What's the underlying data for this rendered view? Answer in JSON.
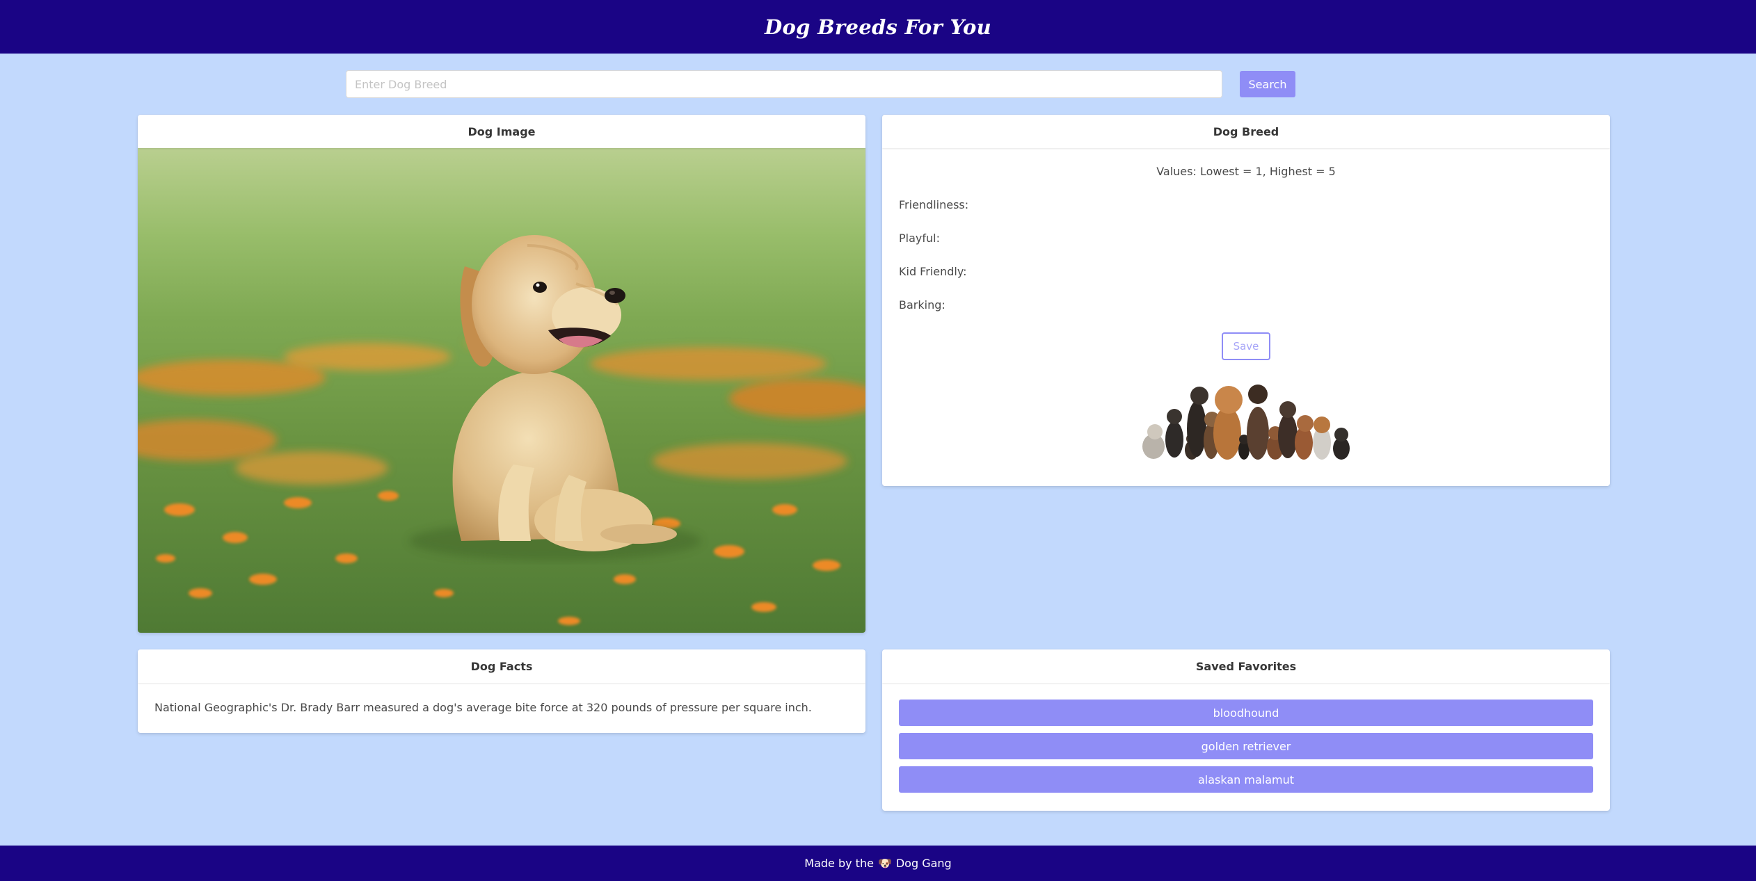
{
  "header": {
    "title": "Dog Breeds For You"
  },
  "search": {
    "placeholder": "Enter Dog Breed",
    "value": "",
    "button_label": "Search"
  },
  "dog_image_card": {
    "title": "Dog Image",
    "image_icon": "golden-retriever-puppy-photo"
  },
  "dog_breed_card": {
    "title": "Dog Breed",
    "values_note": "Values: Lowest = 1, Highest = 5",
    "stats": [
      {
        "label": "Friendliness:",
        "value": ""
      },
      {
        "label": "Playful:",
        "value": ""
      },
      {
        "label": "Kid Friendly:",
        "value": ""
      },
      {
        "label": "Barking:",
        "value": ""
      }
    ],
    "save_label": "Save",
    "group_image_icon": "dog-group-illustration"
  },
  "dog_facts_card": {
    "title": "Dog Facts",
    "fact": "National Geographic's Dr. Brady Barr measured a dog's average bite force at 320 pounds of pressure per square inch."
  },
  "saved_favorites_card": {
    "title": "Saved Favorites",
    "items": [
      "bloodhound",
      "golden retriever",
      "alaskan malamut"
    ]
  },
  "footer": {
    "prefix": "Made by the",
    "emoji": "🐶",
    "suffix": "Dog Gang"
  },
  "colors": {
    "navbar": "#1a0485",
    "page_background": "#c2d9fd",
    "accent": "#8f8df6",
    "card_background": "#ffffff"
  }
}
